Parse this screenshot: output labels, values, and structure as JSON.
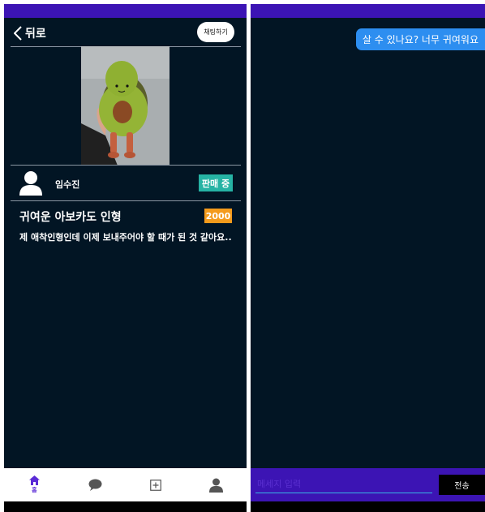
{
  "product_screen": {
    "header": {
      "back_label": "뒤로",
      "chat_button_label": "채팅하기"
    },
    "seller": {
      "name": "임수진",
      "status": "판매 중"
    },
    "product": {
      "title": "귀여운 아보카도 인형",
      "price": "2000",
      "description": "제 애착인형인데 이제 보내주어야 할 때가 된 것 같아요.."
    },
    "bottom_nav": [
      {
        "icon": "home-icon",
        "label": "홈",
        "active": true
      },
      {
        "icon": "chat-bubble-icon",
        "label": ""
      },
      {
        "icon": "add-square-icon",
        "label": ""
      },
      {
        "icon": "profile-icon",
        "label": ""
      }
    ]
  },
  "chat_screen": {
    "messages": [
      {
        "text": "살 수 있나요? 너무 귀여워요",
        "sender": "me"
      }
    ],
    "input": {
      "placeholder": "메세지 입력",
      "value": ""
    },
    "send_label": "전송"
  },
  "colors": {
    "background": "#021524",
    "status_bar": "#3c14b4",
    "selling_badge": "#26b3a4",
    "price_badge": "#f49b1c",
    "message_bubble": "#2d8ef0",
    "nav_accent": "#5b2bd6"
  }
}
